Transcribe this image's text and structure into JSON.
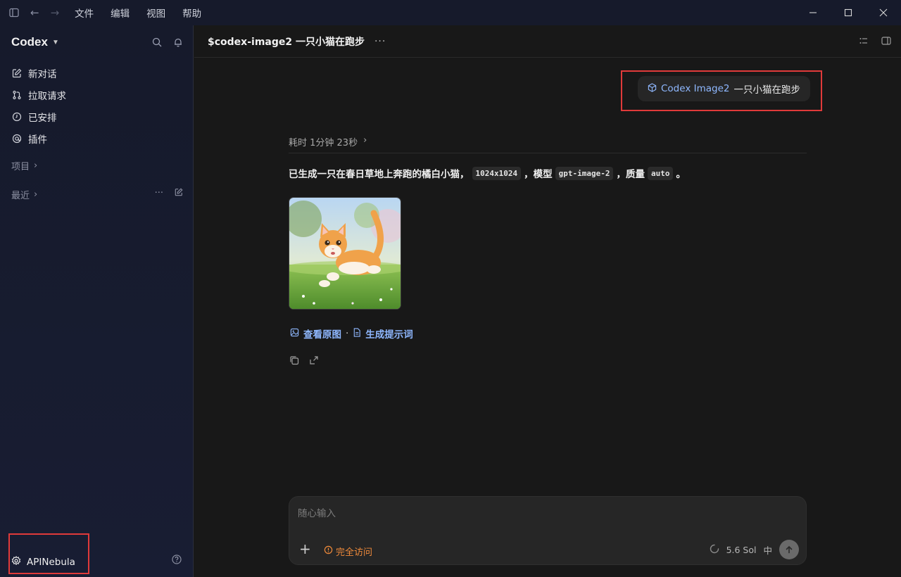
{
  "titlebar": {
    "menu": [
      "文件",
      "编辑",
      "视图",
      "帮助"
    ]
  },
  "sidebar": {
    "brand": "Codex",
    "nav": [
      {
        "label": "新对话",
        "icon": "edit-icon"
      },
      {
        "label": "拉取请求",
        "icon": "pull-request-icon"
      },
      {
        "label": "已安排",
        "icon": "clock-icon"
      },
      {
        "label": "插件",
        "icon": "plugin-icon"
      }
    ],
    "projects_label": "项目",
    "recent_label": "最近",
    "footer_label": "APINebula"
  },
  "main": {
    "title": "$codex-image2 一只小猫在跑步",
    "user_bubble": {
      "skill": "Codex Image2",
      "text": "一只小猫在跑步"
    },
    "elapsed": "耗时 1分钟 23秒",
    "message": {
      "part1": "已生成一只在春日草地上奔跑的橘白小猫，",
      "code1": "1024x1024",
      "part2": "，模型",
      "code2": "gpt-image-2",
      "part3": "，质量",
      "code3": "auto",
      "part4": "。"
    },
    "links": {
      "view_original": "查看原图",
      "sep": "·",
      "prompt": "生成提示词"
    },
    "composer": {
      "placeholder": "随心输入",
      "access": "完全访问",
      "model": "5.6 Sol",
      "effort": "中"
    }
  },
  "colors": {
    "accent_link": "#8fb8ff",
    "warning": "#ef8a3a",
    "highlight_box": "#e03a3a"
  }
}
